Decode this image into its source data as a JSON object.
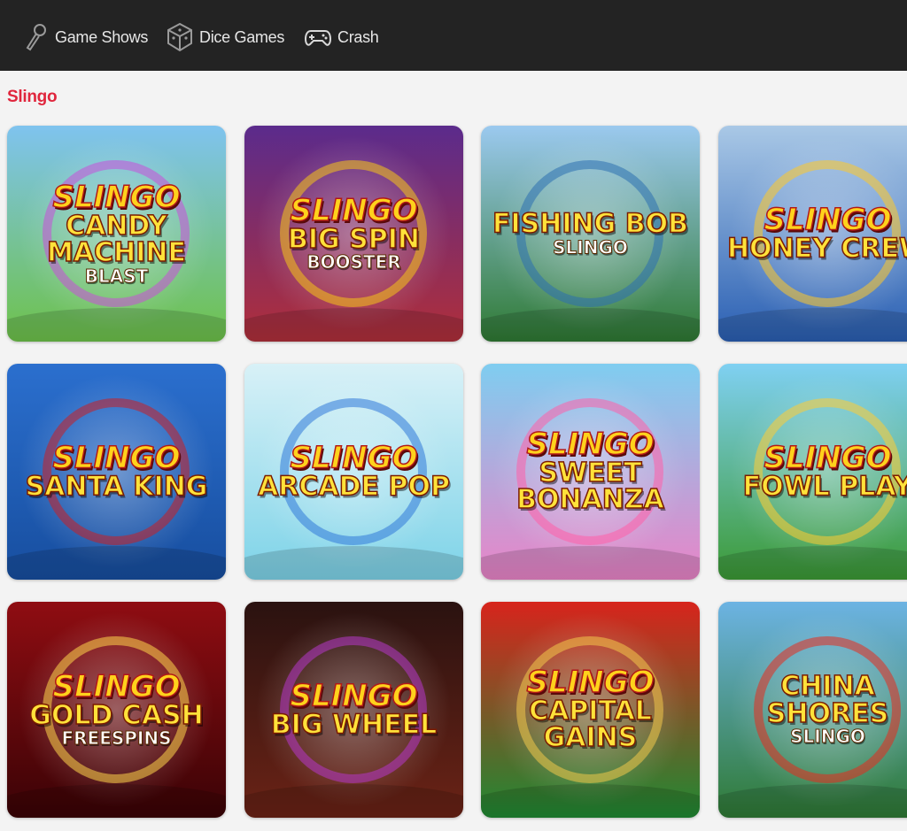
{
  "nav": {
    "items": [
      {
        "label": "Game Shows",
        "icon": "microphone-icon"
      },
      {
        "label": "Dice Games",
        "icon": "dice-icon"
      },
      {
        "label": "Crash",
        "icon": "gamepad-icon"
      }
    ]
  },
  "section": {
    "title": "Slingo"
  },
  "games": [
    {
      "logo": "SLINGO",
      "title": "CANDY MACHINE",
      "sub": "BLAST",
      "bg1": "#7fc3ef",
      "bg2": "#6ec24a",
      "accent": "#c94fd8"
    },
    {
      "logo": "SLINGO",
      "title": "BIG SPIN",
      "sub": "BOOSTER",
      "bg1": "#5b2b8c",
      "bg2": "#b02f3a",
      "accent": "#f5c518"
    },
    {
      "logo": "",
      "title": "FISHING BOB",
      "sub": "SLINGO",
      "bg1": "#9bc9ef",
      "bg2": "#2f7a33",
      "accent": "#2b6fb0"
    },
    {
      "logo": "SLINGO",
      "title": "HONEY CREW",
      "sub": "",
      "bg1": "#a9c8e6",
      "bg2": "#2a5fb3",
      "accent": "#ffc928"
    },
    {
      "logo": "SLINGO",
      "title": "SANTA KING",
      "sub": "",
      "bg1": "#2b6fce",
      "bg2": "#174e9f",
      "accent": "#c81f24"
    },
    {
      "logo": "SLINGO",
      "title": "ARCADE POP",
      "sub": "",
      "bg1": "#d8f1f7",
      "bg2": "#7dd3e8",
      "accent": "#2f79d8"
    },
    {
      "logo": "SLINGO",
      "title": "SWEET BONANZA",
      "sub": "",
      "bg1": "#7fcdf0",
      "bg2": "#e984c7",
      "accent": "#ff5fa8"
    },
    {
      "logo": "SLINGO",
      "title": "FOWL PLAY",
      "sub": "",
      "bg1": "#7fd0f2",
      "bg2": "#3c9a35",
      "accent": "#ffcc33"
    },
    {
      "logo": "SLINGO",
      "title": "GOLD CASH",
      "sub": "FREESPINS",
      "bg1": "#8f0d12",
      "bg2": "#3a0306",
      "accent": "#ffd54a"
    },
    {
      "logo": "SLINGO",
      "title": "BIG WHEEL",
      "sub": "",
      "bg1": "#2a1210",
      "bg2": "#6b2316",
      "accent": "#b437c9"
    },
    {
      "logo": "SLINGO",
      "title": "CAPITAL GAINS",
      "sub": "",
      "bg1": "#d7241c",
      "bg2": "#1f8a33",
      "accent": "#f2c84b"
    },
    {
      "logo": "",
      "title": "CHINA SHORES",
      "sub": "SLINGO",
      "bg1": "#6cb3e3",
      "bg2": "#2f7a34",
      "accent": "#e52b1e"
    }
  ]
}
